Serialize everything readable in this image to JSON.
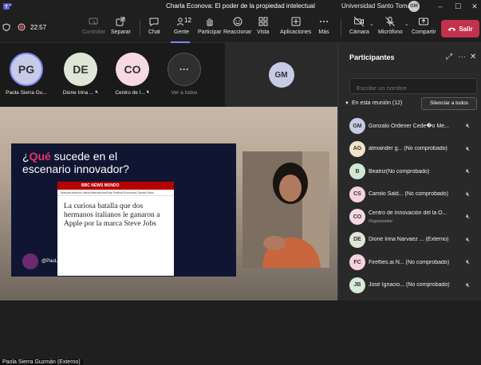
{
  "window": {
    "title": "Charla Econova: El poder de la propiedad intelectual",
    "org": "Universidad Santo Tomás",
    "org_avatar": "GM"
  },
  "meeting": {
    "timer": "22:57"
  },
  "toolbar": {
    "items": [
      {
        "label": "Controlar",
        "icon": "control-icon",
        "disabled": true
      },
      {
        "label": "Separar",
        "icon": "pop-out-icon"
      },
      {
        "label": "Chat",
        "icon": "chat-icon"
      },
      {
        "label": "Gente",
        "icon": "people-icon",
        "count": "12"
      },
      {
        "label": "Participar",
        "icon": "raise-hand-icon"
      },
      {
        "label": "Reaccionar",
        "icon": "react-icon"
      },
      {
        "label": "Vista",
        "icon": "view-icon"
      },
      {
        "label": "Aplicaciones",
        "icon": "apps-icon"
      },
      {
        "label": "Más",
        "icon": "more-icon"
      },
      {
        "label": "Cámara",
        "icon": "camera-off-icon"
      },
      {
        "label": "Micrófono",
        "icon": "mic-off-icon"
      },
      {
        "label": "Compartir",
        "icon": "share-icon"
      }
    ],
    "leave_label": "Salir"
  },
  "tiles": [
    {
      "initials": "PG",
      "name": "Paola Sierra Gu...",
      "color": "#c6cbe8",
      "muted": false
    },
    {
      "initials": "DE",
      "name": "Dione Irina ...",
      "color": "#dfe6d6",
      "muted": true
    },
    {
      "initials": "CO",
      "name": "Centro de I...",
      "color": "#f6d9e3",
      "muted": true
    },
    {
      "initials": "···",
      "name": "Ver a todos",
      "color": "#2f2f2f",
      "muted": false
    }
  ],
  "spotlight": {
    "initials": "GM",
    "color": "#c8cbe6"
  },
  "slide": {
    "title_prefix": "¿",
    "title_highlight": "Qué",
    "title_rest": " sucede en el escenario innovador?",
    "bbc_brand": "BBC NEWS MUNDO",
    "bbc_nav": "Noticias  América Latina  Internacional  Hay Festival  Economía  Ciencia  Salud",
    "headline": "La curiosa batalla que dos hermanos italianos le ganaron a Apple por la marca Steve Jobs",
    "handle": "@PauLawSierra"
  },
  "presenter_tag": "Paola Sierra Guzmán (Externo)",
  "panel": {
    "title": "Participantes",
    "search_placeholder": "Escribe un nombre",
    "section": "En esta reunión (12)",
    "mute_all": "Silenciar a todos",
    "participants": [
      {
        "initials": "GM",
        "name": "Gonzalo Ordener Cede�o Me...",
        "color": "#c8cbe6",
        "sub": ""
      },
      {
        "initials": "AG",
        "name": "alexander g... (No comprobado)",
        "color": "#f2e3c6",
        "sub": ""
      },
      {
        "initials": "B",
        "name": "Beatriz(No comprobado)",
        "color": "#cfe8d6",
        "sub": ""
      },
      {
        "initials": "CS",
        "name": "Camilo Sald... (No comprobado)",
        "color": "#f6d3dc",
        "sub": ""
      },
      {
        "initials": "CO",
        "name": "Centro de Innovación del la O...",
        "color": "#f6d9e3",
        "sub": "Organizador"
      },
      {
        "initials": "DE",
        "name": "Dione Irina Narvaez ... (Externo)",
        "color": "#dfe6d6",
        "sub": ""
      },
      {
        "initials": "FC",
        "name": "Fireflies.ai N... (No comprobado)",
        "color": "#f6d3dc",
        "sub": ""
      },
      {
        "initials": "JB",
        "name": "José Ignacio... (No comprobado)",
        "color": "#d6ead8",
        "sub": ""
      }
    ]
  }
}
